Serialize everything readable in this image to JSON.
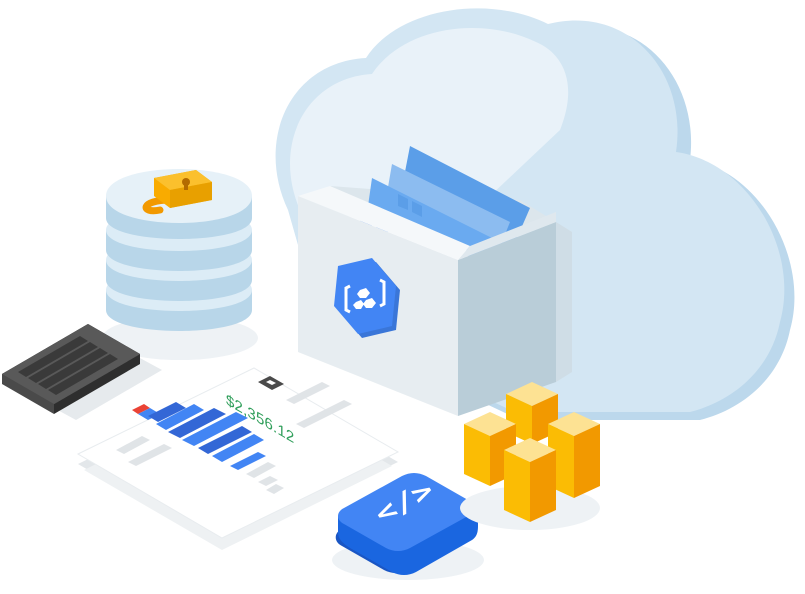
{
  "illustration": {
    "invoice": {
      "amount": "$2,356.12"
    },
    "code_tile": {
      "glyph": "</>"
    },
    "colors": {
      "cloud": "#d3e6f3",
      "cloud_light": "#e9f2f9",
      "drawer_front": "#e7edf1",
      "drawer_side": "#b9cdd8",
      "google_blue": "#4285f4",
      "accent_blue": "#5b9ee8",
      "cube_yellow": "#fbbc04",
      "cube_orange": "#f29900",
      "amount_green": "#2f9e5a",
      "bar_red": "#ea4335",
      "lock_gold": "#f9ab00",
      "vent_dark": "#4a4a4a"
    },
    "icons": [
      "cloud-icon",
      "file-drawer-icon",
      "hexagon-logo-icon",
      "database-icon",
      "padlock-icon",
      "vent-grille-icon",
      "invoice-icon",
      "bar-chart-icon",
      "code-icon",
      "cubes-icon"
    ]
  }
}
